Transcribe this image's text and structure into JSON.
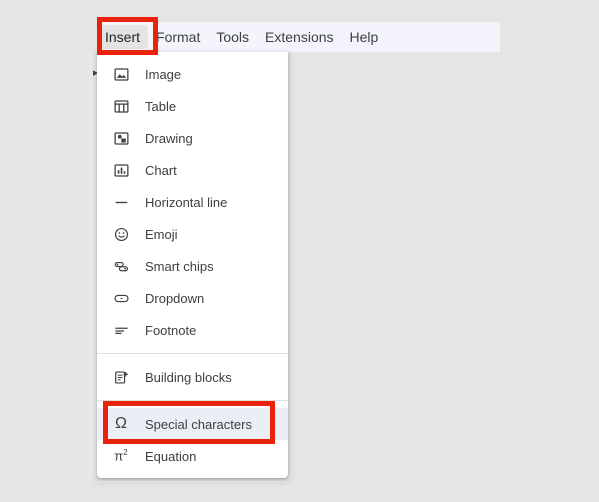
{
  "menubar": {
    "items": [
      {
        "label": "Insert",
        "state": "active"
      },
      {
        "label": "Format",
        "state": "normal"
      },
      {
        "label": "Tools",
        "state": "normal"
      },
      {
        "label": "Extensions",
        "state": "normal"
      },
      {
        "label": "Help",
        "state": "normal"
      }
    ]
  },
  "outline_toggle": {
    "icon": "triangle-right-icon"
  },
  "dropdown": {
    "title": "Insert",
    "groups": [
      {
        "items": [
          {
            "label": "Image",
            "icon": "image-icon",
            "hover": false
          },
          {
            "label": "Table",
            "icon": "table-icon",
            "hover": false
          },
          {
            "label": "Drawing",
            "icon": "drawing-icon",
            "hover": false
          },
          {
            "label": "Chart",
            "icon": "chart-icon",
            "hover": false
          },
          {
            "label": "Horizontal line",
            "icon": "horizontal-line-icon",
            "hover": false
          },
          {
            "label": "Emoji",
            "icon": "emoji-icon",
            "hover": false
          },
          {
            "label": "Smart chips",
            "icon": "smart-chips-icon",
            "hover": false
          },
          {
            "label": "Dropdown",
            "icon": "dropdown-icon",
            "hover": false
          },
          {
            "label": "Footnote",
            "icon": "footnote-icon",
            "hover": false
          }
        ]
      },
      {
        "items": [
          {
            "label": "Building blocks",
            "icon": "building-blocks-icon",
            "hover": false
          }
        ]
      },
      {
        "items": [
          {
            "label": "Special characters",
            "icon": "omega-icon",
            "hover": true,
            "glyph": "Ω"
          },
          {
            "label": "Equation",
            "icon": "equation-icon",
            "hover": false,
            "glyph": "π"
          }
        ]
      }
    ]
  },
  "annotations": {
    "color": "#e8230a",
    "boxes": [
      {
        "target": "Insert",
        "name": "insert-menu-highlight"
      },
      {
        "target": "Special characters",
        "name": "special-characters-highlight"
      }
    ]
  },
  "colors": {
    "background": "#e5e5e5",
    "toolbar_strip": "#f4f5fc",
    "panel": "#ffffff",
    "hover": "#eceef5",
    "text": "#3c4043",
    "annotation": "#e8230a"
  }
}
